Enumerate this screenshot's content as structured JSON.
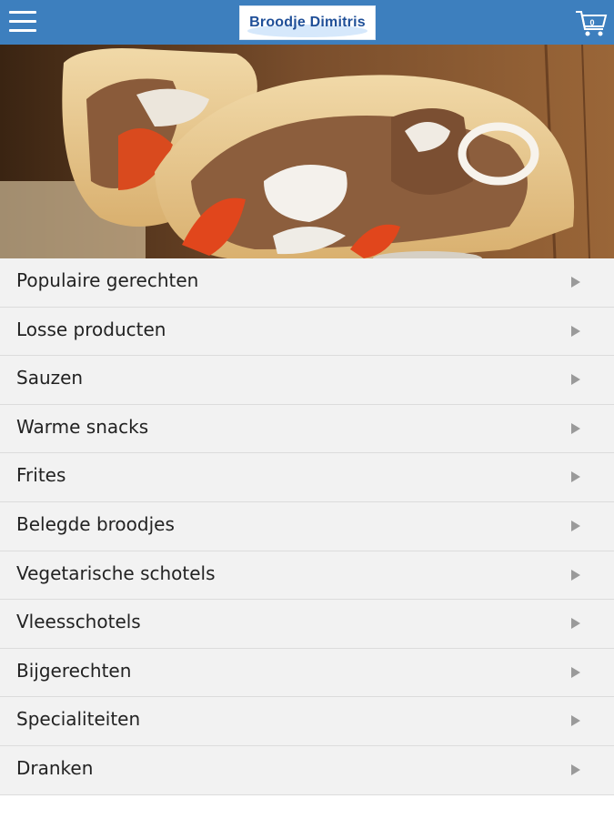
{
  "header": {
    "menu_icon": "hamburger-menu-icon",
    "logo_text": "Broodje Dimitris",
    "cart_icon": "shopping-cart-icon",
    "cart_count": "0",
    "background_color": "#3d7fbe"
  },
  "hero": {
    "image": "gyros-pita-photo"
  },
  "categories": [
    {
      "label": "Populaire gerechten"
    },
    {
      "label": "Losse producten"
    },
    {
      "label": "Sauzen"
    },
    {
      "label": "Warme snacks"
    },
    {
      "label": "Frites"
    },
    {
      "label": "Belegde broodjes"
    },
    {
      "label": "Vegetarische schotels"
    },
    {
      "label": "Vleesschotels"
    },
    {
      "label": "Bijgerechten"
    },
    {
      "label": "Specialiteiten"
    },
    {
      "label": "Dranken"
    }
  ]
}
